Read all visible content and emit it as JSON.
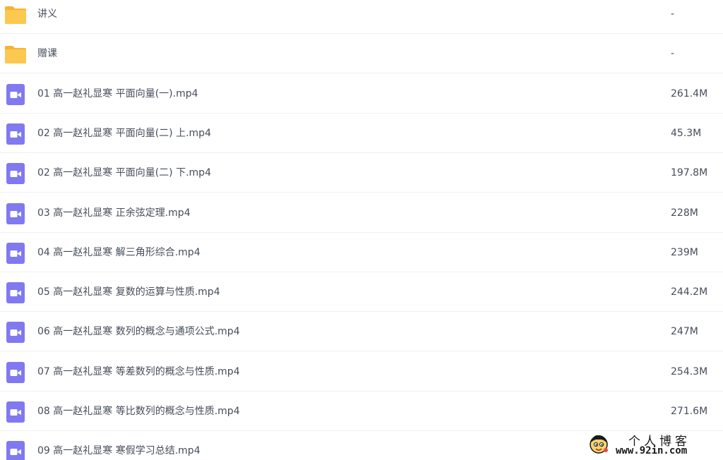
{
  "files": [
    {
      "name": "讲义",
      "size": "-",
      "icon": "folder-icon"
    },
    {
      "name": "赠课",
      "size": "-",
      "icon": "folder-icon"
    },
    {
      "name": "01 高一赵礼显寒 平面向量(一).mp4",
      "size": "261.4M",
      "icon": "video-file-icon"
    },
    {
      "name": "02 高一赵礼显寒 平面向量(二) 上.mp4",
      "size": "45.3M",
      "icon": "video-file-icon"
    },
    {
      "name": "02 高一赵礼显寒 平面向量(二) 下.mp4",
      "size": "197.8M",
      "icon": "video-file-icon"
    },
    {
      "name": "03 高一赵礼显寒 正余弦定理.mp4",
      "size": "228M",
      "icon": "video-file-icon"
    },
    {
      "name": "04 高一赵礼显寒 解三角形综合.mp4",
      "size": "239M",
      "icon": "video-file-icon"
    },
    {
      "name": "05 高一赵礼显寒 复数的运算与性质.mp4",
      "size": "244.2M",
      "icon": "video-file-icon"
    },
    {
      "name": "06 高一赵礼显寒 数列的概念与通项公式.mp4",
      "size": "247M",
      "icon": "video-file-icon"
    },
    {
      "name": "07 高一赵礼显寒 等差数列的概念与性质.mp4",
      "size": "254.3M",
      "icon": "video-file-icon"
    },
    {
      "name": "08 高一赵礼显寒 等比数列的概念与性质.mp4",
      "size": "271.6M",
      "icon": "video-file-icon"
    },
    {
      "name": "09 高一赵礼显寒 寒假学习总结.mp4",
      "size": "",
      "icon": "video-file-icon"
    }
  ],
  "watermark": {
    "title": "个人博客",
    "url": "www.92in.com",
    "icon": "cartoon-face-icon"
  },
  "colors": {
    "folder": "#fcc850",
    "folder_tab": "#f5b333",
    "video": "#8179f0",
    "text": "#454d5a",
    "divider": "#f0f1f3"
  }
}
